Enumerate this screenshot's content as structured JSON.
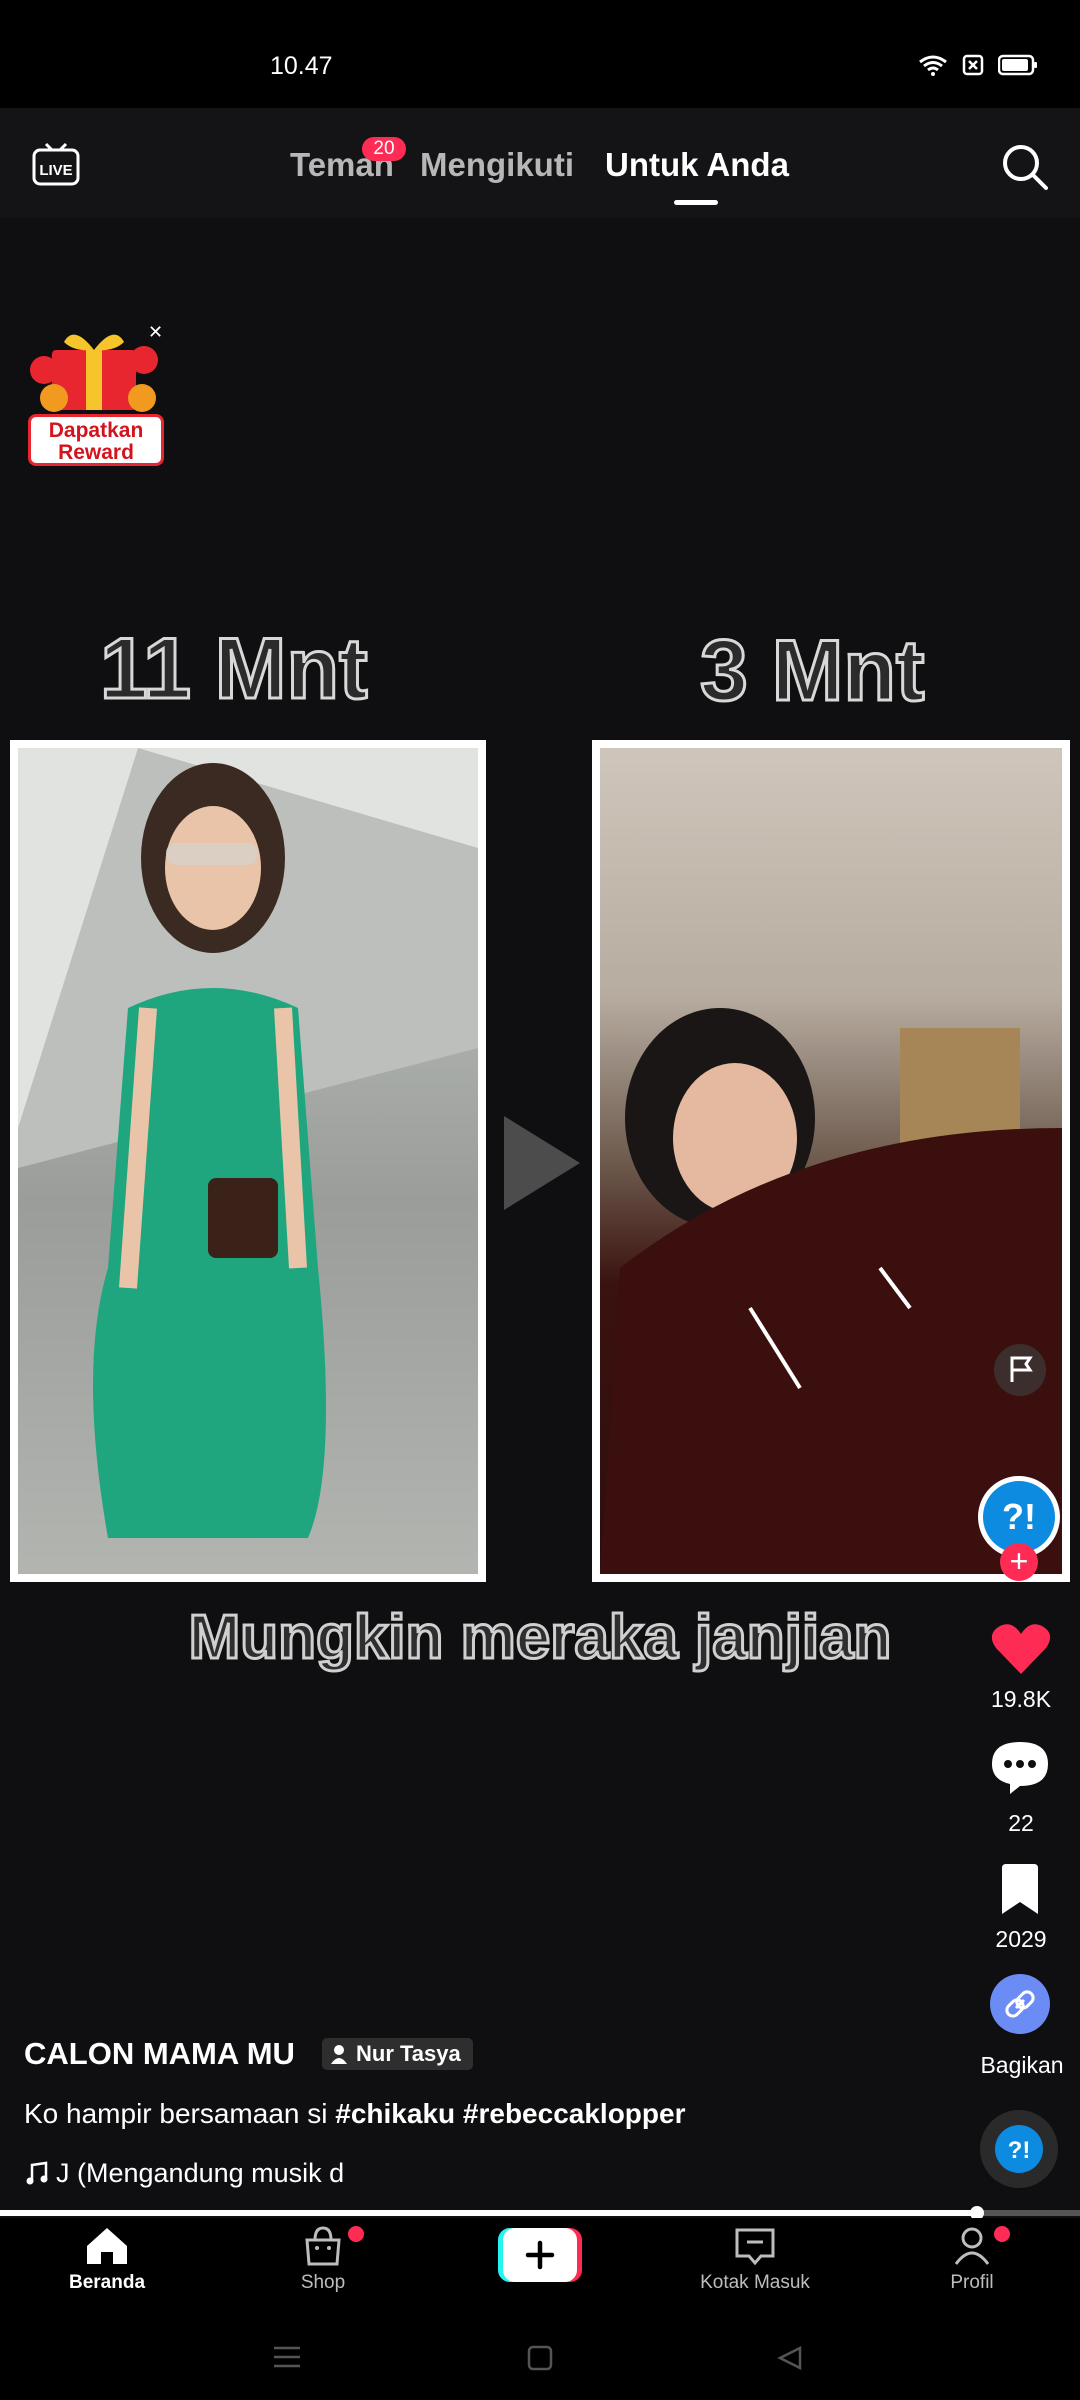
{
  "status_bar": {
    "time": "10.47"
  },
  "top_nav": {
    "live_label": "LIVE",
    "tabs": [
      {
        "label": "Teman",
        "badge": "20"
      },
      {
        "label": "Mengikuti"
      },
      {
        "label": "Untuk Anda",
        "active": true
      }
    ]
  },
  "reward": {
    "label_line1": "Dapatkan",
    "label_line2": "Reward"
  },
  "video": {
    "left_time": "11 Mnt",
    "right_time": "3 Mnt",
    "subtitle": "Mungkin meraka janjian"
  },
  "actions": {
    "likes": "19.8K",
    "comments": "22",
    "bookmarks": "2029",
    "share_label": "Bagikan"
  },
  "post": {
    "username": "CALON MAMA MU",
    "creator": "Nur Tasya",
    "description_text": "Ko hampir bersamaan si ",
    "hashtags": [
      "#chikaku",
      "#rebeccaklopper"
    ],
    "music": "J (Mengandung musik d"
  },
  "progress": {
    "fraction": 0.905
  },
  "bottom_nav": {
    "home": "Beranda",
    "shop": "Shop",
    "inbox": "Kotak Masuk",
    "profile": "Profil"
  },
  "colors": {
    "accent": "#fe2c55",
    "share": "#6b8cf5",
    "background": "#0f0f11"
  }
}
